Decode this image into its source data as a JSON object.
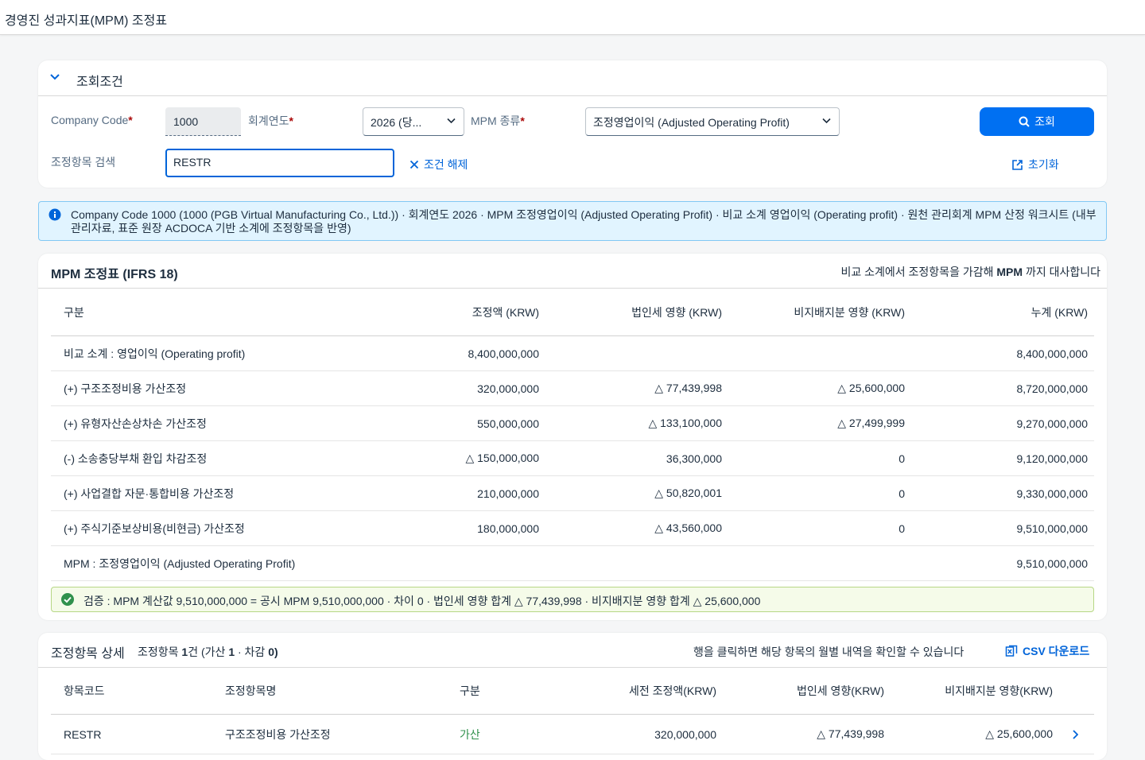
{
  "app": {
    "title": "경영진 성과지표(MPM) 조정표"
  },
  "filter": {
    "title": "조회조건",
    "company_code_label": "Company Code",
    "company_code_value": "1000",
    "fiscal_year_label": "회계연도",
    "fiscal_year_value": "2026 (당...",
    "mpm_type_label": "MPM 종류",
    "mpm_type_value": "조정영업이익 (Adjusted Operating Profit)",
    "required_mark": "*",
    "search_label": "조정항목 검색",
    "search_value": "RESTR",
    "clear_label": "조건 해제",
    "query_label": "조회",
    "reset_label": "초기화"
  },
  "info_text": "Company Code 1000 (1000 (PGB Virtual Manufacturing Co., Ltd.)) · 회계연도 2026 · MPM 조정영업이익 (Adjusted Operating Profit) · 비교 소계 영업이익 (Operating profit) · 원천 관리회계 MPM 산정 워크시트 (내부관리자료, 표준 원장 ACDOCA 기반 소계에 조정항목을 반영)",
  "mpm_table": {
    "title": "MPM 조정표 (IFRS 18)",
    "note_prefix": "비교 소계에서 조정항목을 가감해",
    "note_bold": "MPM",
    "note_suffix": "까지 대사합니다",
    "columns": [
      "구분",
      "조정액 (KRW)",
      "법인세 영향 (KRW)",
      "비지배지분 영향 (KRW)",
      "누계 (KRW)"
    ],
    "rows": [
      [
        "비교 소계 : 영업이익 (Operating profit)",
        "8,400,000,000",
        "",
        "",
        "8,400,000,000"
      ],
      [
        "(+) 구조조정비용 가산조정",
        "320,000,000",
        "△ 77,439,998",
        "△ 25,600,000",
        "8,720,000,000"
      ],
      [
        "(+) 유형자산손상차손 가산조정",
        "550,000,000",
        "△ 133,100,000",
        "△ 27,499,999",
        "9,270,000,000"
      ],
      [
        "(-) 소송충당부채 환입 차감조정",
        "△ 150,000,000",
        "36,300,000",
        "0",
        "9,120,000,000"
      ],
      [
        "(+) 사업결합 자문·통합비용 가산조정",
        "210,000,000",
        "△ 50,820,001",
        "0",
        "9,330,000,000"
      ],
      [
        "(+) 주식기준보상비용(비현금) 가산조정",
        "180,000,000",
        "△ 43,560,000",
        "0",
        "9,510,000,000"
      ],
      [
        "MPM : 조정영업이익 (Adjusted Operating Profit)",
        "",
        "",
        "",
        "9,510,000,000"
      ]
    ],
    "validation": "검증 : MPM 계산값 9,510,000,000 = 공시 MPM 9,510,000,000 · 차이 0 · 법인세 영향 합계 △ 77,439,998 · 비지배지분 영향 합계 △ 25,600,000"
  },
  "detail": {
    "title": "조정항목 상세",
    "sub_prefix": "조정항목",
    "sub_count": "1",
    "sub_mid": "건 (가산",
    "sub_add": "1",
    "sub_sep": "· 차감",
    "sub_sub": "0)",
    "hint": "행을 클릭하면 해당 항목의 월별 내역을 확인할 수 있습니다",
    "csv_label": "CSV 다운로드",
    "columns": [
      "항목코드",
      "조정항목명",
      "구분",
      "세전 조정액(KRW)",
      "법인세 영향(KRW)",
      "비지배지분 영향(KRW)"
    ],
    "rows": [
      [
        "RESTR",
        "구조조정비용 가산조정",
        "가산",
        "320,000,000",
        "△ 77,439,998",
        "△ 25,600,000"
      ]
    ]
  },
  "colors": {
    "accent": "#0070f2",
    "positive": "#30914c",
    "info_bg": "#e1f4ff",
    "success_bg": "#f5fbe9"
  }
}
